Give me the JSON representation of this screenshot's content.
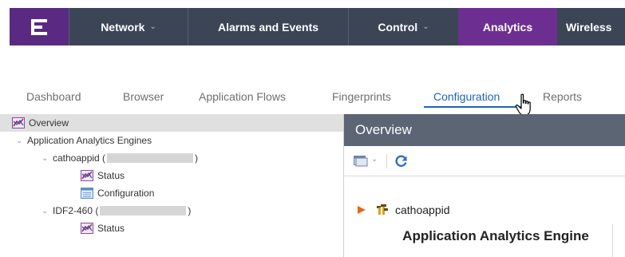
{
  "colors": {
    "nav_background": "#3b4556",
    "nav_active": "#6d2e91",
    "logo_background": "#5a2a82",
    "tab_active": "#1f62b8",
    "panel_header": "#5b6573",
    "refresh_icon": "#2f6fc4",
    "expand_arrow": "#e8641b"
  },
  "nav": {
    "items": [
      {
        "label": "Network",
        "has_dropdown": true
      },
      {
        "label": "Alarms and Events",
        "has_dropdown": false
      },
      {
        "label": "Control",
        "has_dropdown": true
      },
      {
        "label": "Analytics",
        "has_dropdown": false,
        "active": true
      },
      {
        "label": "Wireless",
        "has_dropdown": false
      }
    ]
  },
  "subtabs": [
    {
      "label": "Dashboard"
    },
    {
      "label": "Browser"
    },
    {
      "label": "Application Flows"
    },
    {
      "label": "Fingerprints"
    },
    {
      "label": "Configuration",
      "active": true
    },
    {
      "label": "Reports"
    }
  ],
  "tree": {
    "items": [
      {
        "label": "Overview",
        "icon": "chart-icon",
        "selected": true
      },
      {
        "label": "Application Analytics Engines",
        "expanded": true
      },
      {
        "label": "cathoappid (",
        "suffix": ")",
        "expanded": true
      },
      {
        "label": "Status",
        "icon": "chart-icon"
      },
      {
        "label": "Configuration",
        "icon": "config-icon"
      },
      {
        "label": "IDF2-460 (",
        "suffix": ")",
        "expanded": true
      },
      {
        "label": "Status",
        "icon": "chart-icon"
      }
    ]
  },
  "panel": {
    "title": "Overview",
    "node_label": "cathoappid",
    "node_title": "Application Analytics Engine"
  }
}
